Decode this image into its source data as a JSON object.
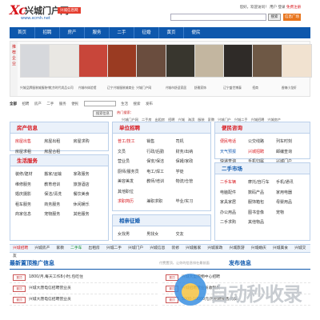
{
  "header": {
    "logo_mark": "Xc",
    "logo_cn": "兴城门户网",
    "logo_url": "www.xcmh.net",
    "sub_badge": "兴城信息网",
    "topright_text": "您好，欢迎访问！",
    "topright_link1": "用户",
    "topright_link2": "登录",
    "topright_reg": "免费注册",
    "search_btn": "搜索",
    "plaza_btn": "信息广场"
  },
  "nav": [
    "首页",
    "招聘",
    "房产",
    "服务",
    "二手",
    "征婚",
    "黄页",
    "便民"
  ],
  "ads": {
    "label": "推荐企业",
    "items": [
      {
        "caption": "兴城品牌服装城服装中心",
        "color": "#d6d8dc"
      },
      {
        "caption": "北京时代尚品公司",
        "color": "#e9e7e3"
      },
      {
        "caption": "兴城市体验馆",
        "color": "#c8463a"
      },
      {
        "caption": "辽宁兴城服装城商业",
        "color": "#9a3b22"
      },
      {
        "caption": "兴城门户网",
        "color": "#6a4d3e"
      },
      {
        "caption": "兴城市舒适家居",
        "color": "#38362e"
      },
      {
        "caption": "舒雅家饰",
        "color": "#c3b6a0"
      },
      {
        "caption": "辽宁盛世博泰",
        "color": "#2f2b28"
      },
      {
        "caption": "招商",
        "color": "#6e5845"
      },
      {
        "caption": "香辣小龙虾",
        "color": "#f1e2d0"
      }
    ]
  },
  "quick": {
    "label": "全部",
    "items": [
      "招聘",
      "房产",
      "二手",
      "服务",
      "便民"
    ],
    "links": [
      "生活",
      "搜索",
      "发布"
    ]
  },
  "hot": {
    "button": "搜索信息",
    "title": "热门搜索：",
    "links": [
      "兴城门户网",
      "二手房",
      "出租房",
      "招聘",
      "兴城",
      "海滨",
      "服装",
      "家教",
      "兴城门户",
      "兴城二手",
      "兴城招聘",
      "兴城房产"
    ]
  },
  "panels": {
    "house": {
      "title": "房产信息",
      "cells": [
        {
          "t": "房屋出售",
          "c": "red"
        },
        {
          "t": "房屋出租",
          "c": ""
        },
        {
          "t": "房屋求购",
          "c": ""
        },
        {
          "t": "房屋求租",
          "c": ""
        },
        {
          "t": "房屋合租",
          "c": ""
        },
        {
          "t": "",
          "c": ""
        }
      ]
    },
    "job": {
      "title": "单位招聘",
      "cells": [
        {
          "t": "普工/技工",
          "c": "red"
        },
        {
          "t": "销售",
          "c": ""
        },
        {
          "t": "司机",
          "c": ""
        },
        {
          "t": "文员",
          "c": ""
        },
        {
          "t": "行政/后勤",
          "c": ""
        },
        {
          "t": "财务/出纳",
          "c": ""
        },
        {
          "t": "营业员",
          "c": ""
        },
        {
          "t": "保安/保洁",
          "c": ""
        },
        {
          "t": "保姆/家政",
          "c": ""
        },
        {
          "t": "厨师/服务员",
          "c": ""
        },
        {
          "t": "电工/焊工",
          "c": ""
        },
        {
          "t": "学徒",
          "c": ""
        },
        {
          "t": "美容美发",
          "c": ""
        },
        {
          "t": "教师/培训",
          "c": ""
        },
        {
          "t": "物流/仓管",
          "c": ""
        },
        {
          "t": "其他职位",
          "c": ""
        },
        {
          "t": "",
          "c": ""
        },
        {
          "t": "",
          "c": ""
        },
        {
          "t": "求职简历",
          "c": "red"
        },
        {
          "t": "兼职求职",
          "c": ""
        },
        {
          "t": "毕业/实习",
          "c": ""
        }
      ]
    },
    "convenience": {
      "title": "便民咨询",
      "cells": [
        {
          "t": "便民电话",
          "c": "red"
        },
        {
          "t": "公交线路",
          "c": ""
        },
        {
          "t": "列车时刻",
          "c": ""
        },
        {
          "t": "天气预报",
          "c": "blue"
        },
        {
          "t": "兴城招聘",
          "c": "red"
        },
        {
          "t": "邮编查询",
          "c": ""
        },
        {
          "t": "快递查询",
          "c": ""
        },
        {
          "t": "手机归属",
          "c": ""
        },
        {
          "t": "兴城门户",
          "c": ""
        }
      ]
    },
    "life": {
      "title": "生活服务",
      "cells": [
        {
          "t": "装修/建材",
          "c": ""
        },
        {
          "t": "搬家/运输",
          "c": ""
        },
        {
          "t": "家政服务",
          "c": ""
        },
        {
          "t": "维修服务",
          "c": ""
        },
        {
          "t": "教育培训",
          "c": ""
        },
        {
          "t": "旅游酒店",
          "c": ""
        },
        {
          "t": "婚庆摄影",
          "c": ""
        },
        {
          "t": "保洁/清洗",
          "c": ""
        },
        {
          "t": "餐饮美食",
          "c": ""
        },
        {
          "t": "租车服务",
          "c": ""
        },
        {
          "t": "商务服务",
          "c": ""
        },
        {
          "t": "休闲娱乐",
          "c": ""
        },
        {
          "t": "商家信息",
          "c": ""
        },
        {
          "t": "宠物服务",
          "c": ""
        },
        {
          "t": "其他服务",
          "c": ""
        }
      ]
    },
    "relation": {
      "title": "相亲征婚",
      "cells": [
        {
          "t": "女找男",
          "c": ""
        },
        {
          "t": "男找女",
          "c": ""
        },
        {
          "t": "交友",
          "c": ""
        }
      ]
    },
    "second": {
      "title": "二手市场",
      "cells": [
        {
          "t": "二手车辆",
          "c": "red"
        },
        {
          "t": "摩托/自行车",
          "c": ""
        },
        {
          "t": "手机/通讯",
          "c": ""
        },
        {
          "t": "电脑配件",
          "c": ""
        },
        {
          "t": "数码产品",
          "c": ""
        },
        {
          "t": "家用电器",
          "c": ""
        },
        {
          "t": "家具家居",
          "c": ""
        },
        {
          "t": "服饰箱包",
          "c": ""
        },
        {
          "t": "母婴用品",
          "c": ""
        },
        {
          "t": "办公用品",
          "c": ""
        },
        {
          "t": "图书音像",
          "c": ""
        },
        {
          "t": "宠物",
          "c": ""
        },
        {
          "t": "二手求购",
          "c": ""
        },
        {
          "t": "其他物品",
          "c": ""
        },
        {
          "t": "",
          "c": ""
        }
      ]
    }
  },
  "linkbar": [
    {
      "t": "兴城招聘",
      "c": "red"
    },
    {
      "t": "兴城房产",
      "c": ""
    },
    {
      "t": "家教",
      "c": ""
    },
    {
      "t": "二手车",
      "c": "green"
    },
    {
      "t": "出租房",
      "c": ""
    },
    {
      "t": "兴城二手",
      "c": ""
    },
    {
      "t": "兴城门户",
      "c": ""
    },
    {
      "t": "兴城信息",
      "c": ""
    },
    {
      "t": "装修",
      "c": ""
    },
    {
      "t": "兴城搬家",
      "c": ""
    },
    {
      "t": "兴城家政",
      "c": ""
    },
    {
      "t": "兴城旅游",
      "c": ""
    },
    {
      "t": "兴城婚庆",
      "c": ""
    },
    {
      "t": "兴城美食",
      "c": ""
    },
    {
      "t": "兴城交友",
      "c": ""
    }
  ],
  "bottom": {
    "title": "最新置顶推广信息",
    "notice": "付费置顶，让你的信息排在最前面",
    "title2": "发布信息",
    "left_items": [
      {
        "tag": "置顶",
        "text": "1800/月,每天工作8小时,包吃住"
      },
      {
        "tag": "置顶",
        "text": "兴城大唐电信招聘营业员"
      },
      {
        "tag": "置顶",
        "text": "兴城大唐电信招聘营业员"
      }
    ],
    "right_items": [
      {
        "tag": "置顶",
        "text": "兴城大型购物中心招聘"
      },
      {
        "tag": "置顶",
        "text": "兴城招聘营业员收银员"
      },
      {
        "tag": "置顶",
        "text": "5000-10000元/月招聘销售代表"
      }
    ],
    "watermark": "自动秒收录"
  }
}
